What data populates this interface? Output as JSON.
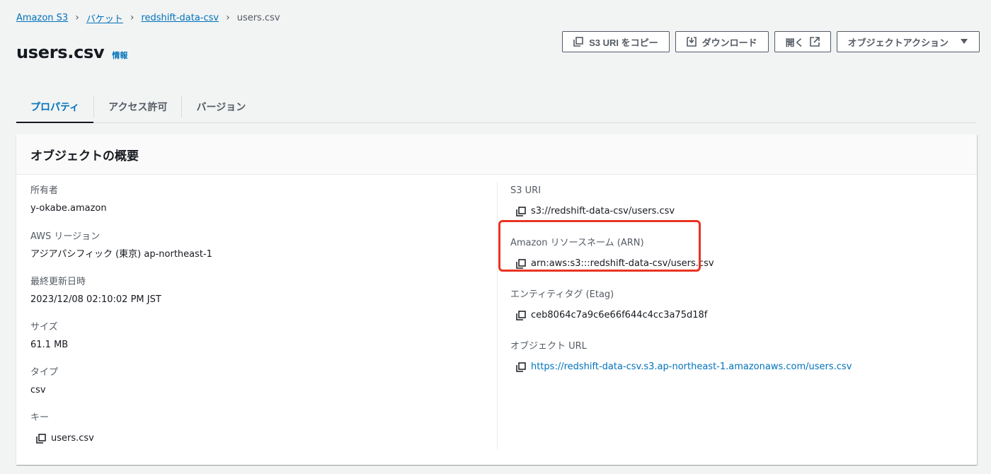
{
  "breadcrumb": {
    "items": [
      "Amazon S3",
      "バケット",
      "redshift-data-csv"
    ],
    "current": "users.csv"
  },
  "title": "users.csv",
  "info_link": "情報",
  "actions": {
    "copy_uri": "S3 URI をコピー",
    "download": "ダウンロード",
    "open": "開く",
    "object_actions": "オブジェクトアクション"
  },
  "tabs": [
    "プロパティ",
    "アクセス許可",
    "バージョン"
  ],
  "active_tab": "プロパティ",
  "panel": {
    "title": "オブジェクトの概要",
    "left": [
      {
        "label": "所有者",
        "value": "y-okabe.amazon"
      },
      {
        "label": "AWS リージョン",
        "value": "アジアパシフィック (東京) ap-northeast-1"
      },
      {
        "label": "最終更新日時",
        "value": "2023/12/08 02:10:02 PM JST"
      },
      {
        "label": "サイズ",
        "value": "61.1 MB"
      },
      {
        "label": "タイプ",
        "value": "csv"
      },
      {
        "label": "キー",
        "value": "users.csv"
      }
    ],
    "right": [
      {
        "label": "S3 URI",
        "value": "s3://redshift-data-csv/users.csv"
      },
      {
        "label": "Amazon リソースネーム (ARN)",
        "value": "arn:aws:s3:::redshift-data-csv/users.csv"
      },
      {
        "label": "エンティティタグ (Etag)",
        "value": "ceb8064c7a9c6e66f644c4cc3a75d18f"
      },
      {
        "label": "オブジェクト URL",
        "value": "https://redshift-data-csv.s3.ap-northeast-1.amazonaws.com/users.csv"
      }
    ]
  },
  "colors": {
    "link": "#0073bb",
    "highlight": "#ea3323",
    "background": "#f2f3f3"
  }
}
